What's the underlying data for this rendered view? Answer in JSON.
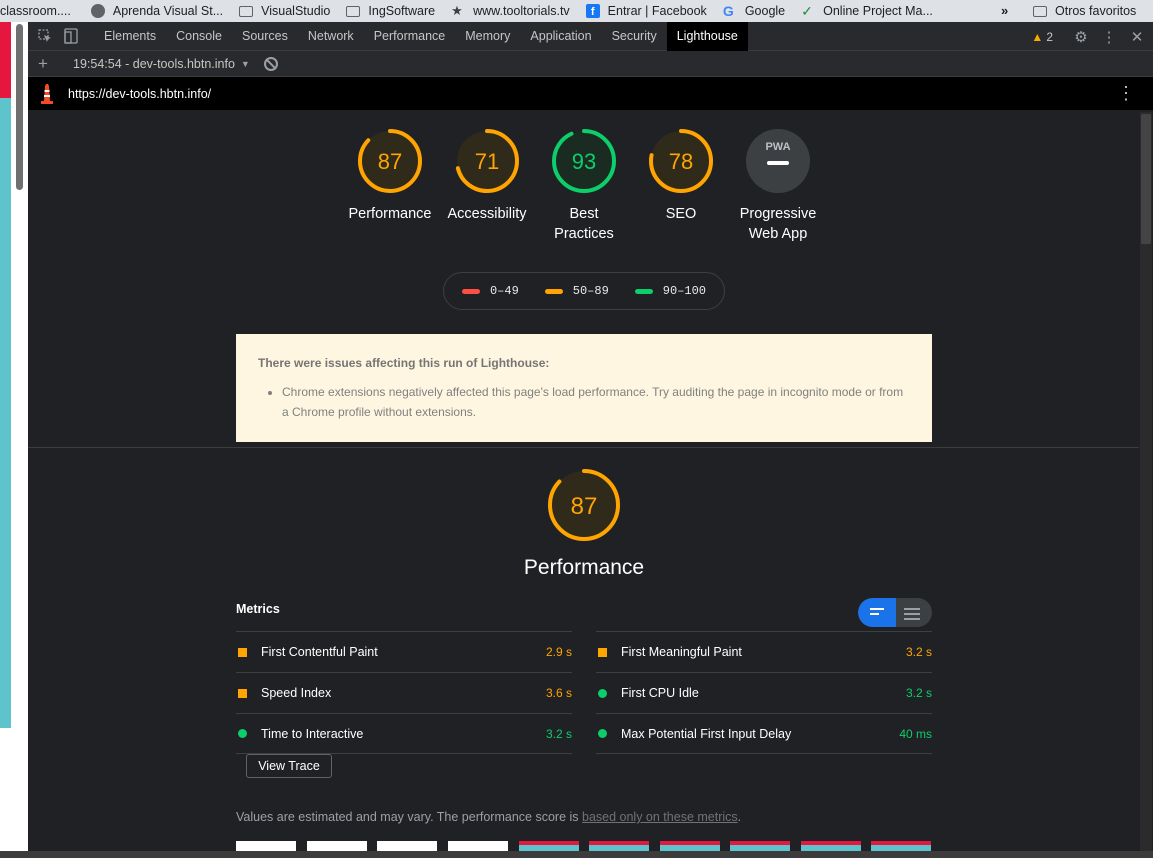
{
  "bookmarks": {
    "items": [
      {
        "label": "classroom....",
        "icon": "folder-icon"
      },
      {
        "label": "Aprenda Visual St...",
        "icon": "globe-icon"
      },
      {
        "label": "VisualStudio",
        "icon": "folder-icon"
      },
      {
        "label": "IngSoftware",
        "icon": "folder-icon"
      },
      {
        "label": "www.tooltorials.tv",
        "icon": "star-icon"
      },
      {
        "label": "Entrar | Facebook",
        "icon": "facebook-icon"
      },
      {
        "label": "Google",
        "icon": "google-icon"
      },
      {
        "label": "Online Project Ma...",
        "icon": "check-icon"
      }
    ],
    "more": "»",
    "other": "Otros favoritos"
  },
  "devtools": {
    "tabs": [
      "Elements",
      "Console",
      "Sources",
      "Network",
      "Performance",
      "Memory",
      "Application",
      "Security",
      "Lighthouse"
    ],
    "active_tab": "Lighthouse",
    "warning_count": "2",
    "report_selector": "19:54:54 - dev-tools.hbtn.info",
    "url": "https://dev-tools.hbtn.info/"
  },
  "categories": [
    {
      "score": "87",
      "label": "Performance",
      "status": "average",
      "fraction": 0.87
    },
    {
      "score": "71",
      "label": "Accessibility",
      "status": "average",
      "fraction": 0.71
    },
    {
      "score": "93",
      "label": "Best Practices",
      "status": "pass",
      "fraction": 0.93
    },
    {
      "score": "78",
      "label": "SEO",
      "status": "average",
      "fraction": 0.78
    }
  ],
  "pwa": {
    "label": "Progressive Web App",
    "badge": "PWA"
  },
  "legend": [
    {
      "range": "0–49",
      "color": "#ff4e42"
    },
    {
      "range": "50–89",
      "color": "#ffa400"
    },
    {
      "range": "90–100",
      "color": "#0cce6b"
    }
  ],
  "warning": {
    "title": "There were issues affecting this run of Lighthouse:",
    "items": [
      "Chrome extensions negatively affected this page's load performance. Try auditing the page in incognito mode or from a Chrome profile without extensions."
    ]
  },
  "performance": {
    "score": "87",
    "title": "Performance",
    "fraction": 0.87
  },
  "metrics": {
    "heading": "Metrics",
    "left": [
      {
        "name": "First Contentful Paint",
        "value": "2.9 s",
        "status": "average"
      },
      {
        "name": "Speed Index",
        "value": "3.6 s",
        "status": "average"
      },
      {
        "name": "Time to Interactive",
        "value": "3.2 s",
        "status": "pass"
      }
    ],
    "right": [
      {
        "name": "First Meaningful Paint",
        "value": "3.2 s",
        "status": "average"
      },
      {
        "name": "First CPU Idle",
        "value": "3.2 s",
        "status": "pass"
      },
      {
        "name": "Max Potential First Input Delay",
        "value": "40 ms",
        "status": "pass"
      }
    ]
  },
  "view_trace": "View Trace",
  "note": {
    "prefix": "Values are estimated and may vary. The performance score is ",
    "link": "based only on these metrics",
    "suffix": "."
  },
  "colors": {
    "average": "#ffa400",
    "pass": "#0cce6b",
    "fail": "#ff4e42",
    "accent": "#1a73e8"
  }
}
